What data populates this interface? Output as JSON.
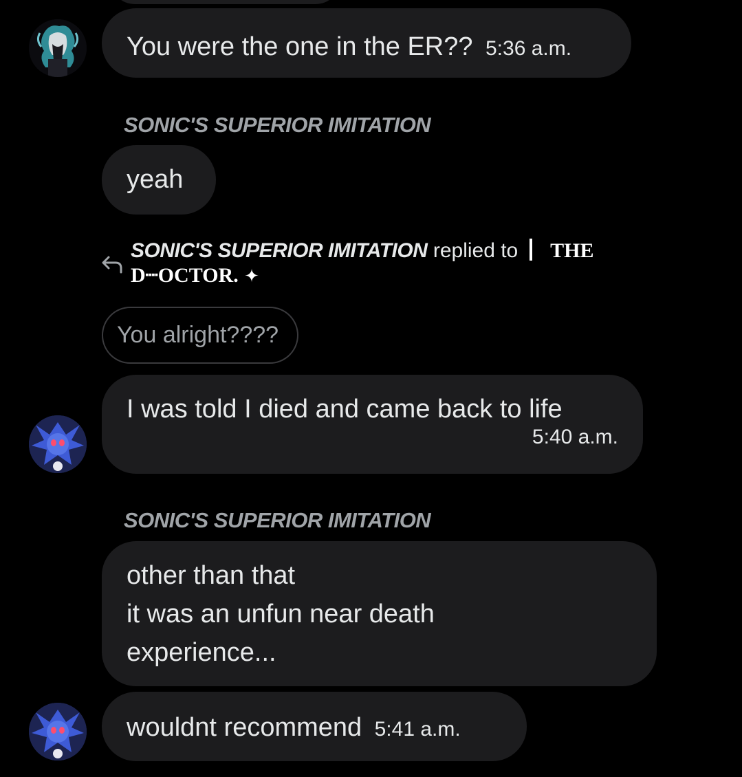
{
  "messages": [
    {
      "text": "You were the one in the ER??",
      "time": "5:36 a.m."
    },
    {
      "sender": "SONIC'S SUPERIOR IMITATION",
      "text": "yeah"
    },
    {
      "text": "I was told I died and came back to life",
      "time": "5:40 a.m."
    },
    {
      "sender": "SONIC'S SUPERIOR IMITATION",
      "text": "other than that\nit was an unfun near death\nexperience..."
    },
    {
      "text": "wouldnt recommend",
      "time": "5:41 a.m."
    }
  ],
  "reply": {
    "sender": "SONIC'S SUPERIOR IMITATION",
    "verb": "replied to",
    "target_line1": "THE",
    "target_line2": "D┈OCTOR.",
    "target_symbol": "✦",
    "quoted": "You alright????"
  },
  "colors": {
    "background": "#000000",
    "bubble": "#1c1c1e",
    "sender_name": "#a0a4a8",
    "text": "#e7e9ea"
  }
}
